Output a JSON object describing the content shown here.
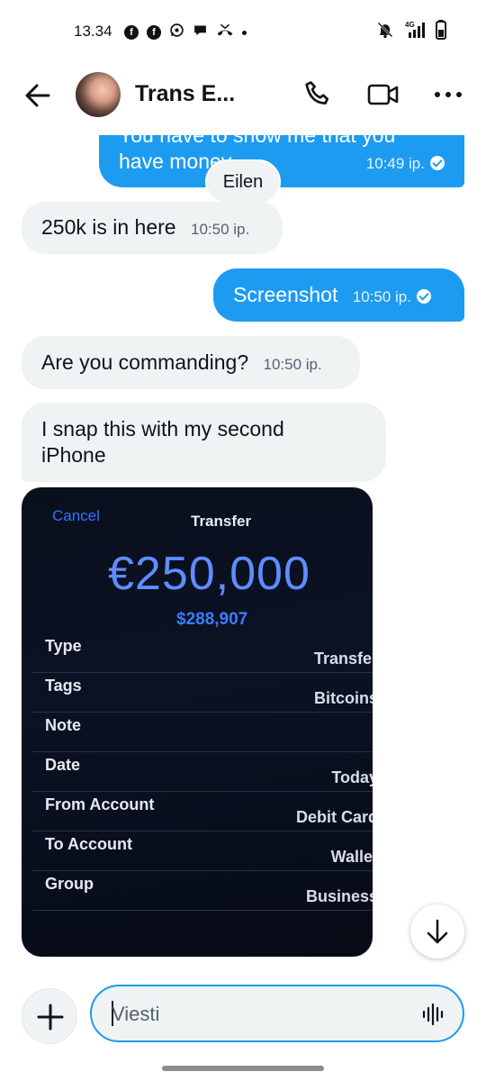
{
  "status_bar": {
    "time": "13.34",
    "network": "4G"
  },
  "header": {
    "contact_name": "Trans E..."
  },
  "messages": [
    {
      "direction": "out",
      "text_line1": "You have to show me that you",
      "text_line2": "have money",
      "time": "10:49 ip.",
      "reaction": "Eilen"
    },
    {
      "direction": "in",
      "text": "250k is in here",
      "time": "10:50 ip."
    },
    {
      "direction": "out",
      "text": "Screenshot",
      "time": "10:50 ip."
    },
    {
      "direction": "in",
      "text": "Are you commanding?",
      "time": "10:50 ip."
    },
    {
      "direction": "in",
      "text_line1": "I snap this with my second",
      "text_line2": "iPhone"
    }
  ],
  "photo": {
    "cancel": "Cancel",
    "title": "Transfer",
    "amount": "€250,000",
    "converted": "$288,907",
    "rows": [
      {
        "label": "Type",
        "value": "Transfer"
      },
      {
        "label": "Tags",
        "value": "Bitcoins"
      },
      {
        "label": "Note",
        "value": ""
      },
      {
        "label": "Date",
        "value": "Today"
      },
      {
        "label": "From Account",
        "value": "Debit Card"
      },
      {
        "label": "To Account",
        "value": "Wallet"
      },
      {
        "label": "Group",
        "value": "Business"
      }
    ]
  },
  "composer": {
    "placeholder": "Viesti"
  },
  "colors": {
    "accent": "#1d9bf0",
    "incoming_bubble": "#eff3f4"
  }
}
